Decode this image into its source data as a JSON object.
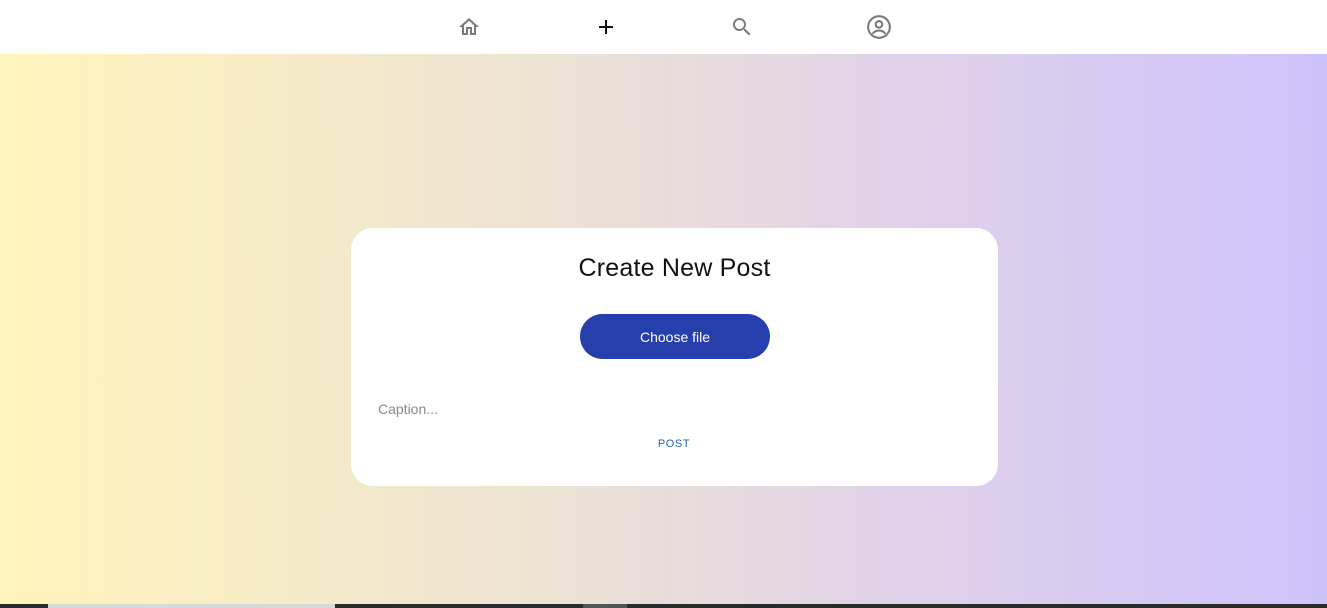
{
  "nav": {
    "items": [
      {
        "icon": "home-icon",
        "label": "Home"
      },
      {
        "icon": "plus-icon",
        "label": "Create"
      },
      {
        "icon": "search-icon",
        "label": "Search"
      },
      {
        "icon": "account-circle-icon",
        "label": "Profile"
      }
    ]
  },
  "card": {
    "title": "Create New Post",
    "choose_file_label": "Choose file",
    "caption_placeholder": "Caption...",
    "caption_value": "",
    "post_label": "POST"
  },
  "colors": {
    "primary_button": "#263fad",
    "post_link": "#1f63b5",
    "gradient_start": "#fff4bb",
    "gradient_end": "#cec2fb",
    "nav_icon_inactive": "#7a7a7a",
    "nav_icon_active": "#111111"
  }
}
